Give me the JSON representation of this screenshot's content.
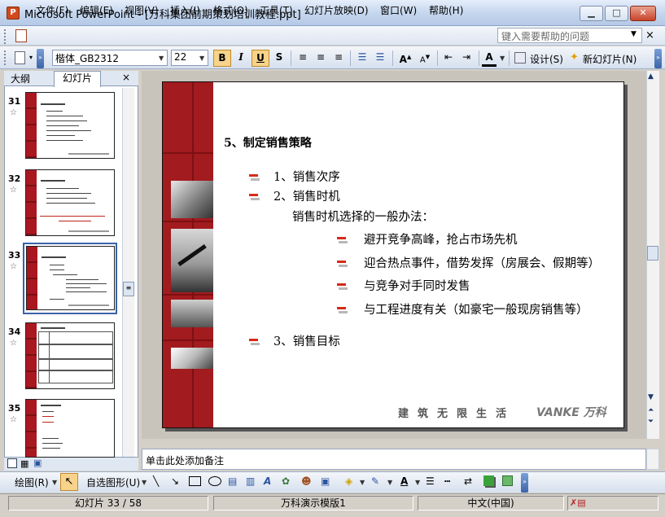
{
  "window": {
    "title": "Microsoft PowerPoint - [万科集团前期策划培训教程.ppt]",
    "minimize": "▁",
    "maximize": "□",
    "close": "✕"
  },
  "menu": {
    "items": [
      "文件(F)",
      "编辑(E)",
      "视图(V)",
      "插入(I)",
      "格式(O)",
      "工具(T)",
      "幻灯片放映(D)",
      "窗口(W)",
      "帮助(H)"
    ],
    "help_placeholder": "键入需要帮助的问题",
    "close": "×"
  },
  "toolbar": {
    "font_name": "楷体_GB2312",
    "font_size": "22",
    "bold": "B",
    "italic": "I",
    "underline": "U",
    "shadow": "S",
    "design": "设计(S)",
    "new_slide": "新幻灯片(N)"
  },
  "pane": {
    "tab_outline": "大纲",
    "tab_slides": "幻灯片",
    "close": "×",
    "thumbnails": [
      {
        "number": "31"
      },
      {
        "number": "32"
      },
      {
        "number": "33",
        "selected": true
      },
      {
        "number": "34"
      },
      {
        "number": "35"
      }
    ]
  },
  "slide": {
    "title": "5、制定销售策略",
    "items": [
      {
        "level": 1,
        "bullet": true,
        "text": "1、销售次序"
      },
      {
        "level": 1,
        "bullet": true,
        "text": "2、销售时机"
      },
      {
        "level": 1,
        "bullet": false,
        "text": "销售时机选择的一般办法："
      },
      {
        "level": 2,
        "bullet": true,
        "text": "避开竞争高峰，抢占市场先机"
      },
      {
        "level": 2,
        "bullet": true,
        "text": "迎合热点事件，借势发挥（房展会、假期等）"
      },
      {
        "level": 2,
        "bullet": true,
        "text": "与竞争对手同时发售"
      },
      {
        "level": 2,
        "bullet": true,
        "text": "与工程进度有关（如豪宅一般现房销售等）"
      },
      {
        "level": 1,
        "bullet": true,
        "text": "3、销售目标"
      }
    ],
    "footer": "建筑无限生活",
    "brand": "VANKE 万科"
  },
  "notes": {
    "placeholder": "单击此处添加备注"
  },
  "drawbar": {
    "draw": "绘图(R)",
    "autoshapes": "自选图形(U)"
  },
  "status": {
    "slide_pos": "幻灯片 33 / 58",
    "template": "万科演示模版1",
    "language": "中文(中国)"
  },
  "colors": {
    "band": "#a21b1f",
    "bullet_red": "#d72a1a",
    "selection": "#3a63a8"
  }
}
